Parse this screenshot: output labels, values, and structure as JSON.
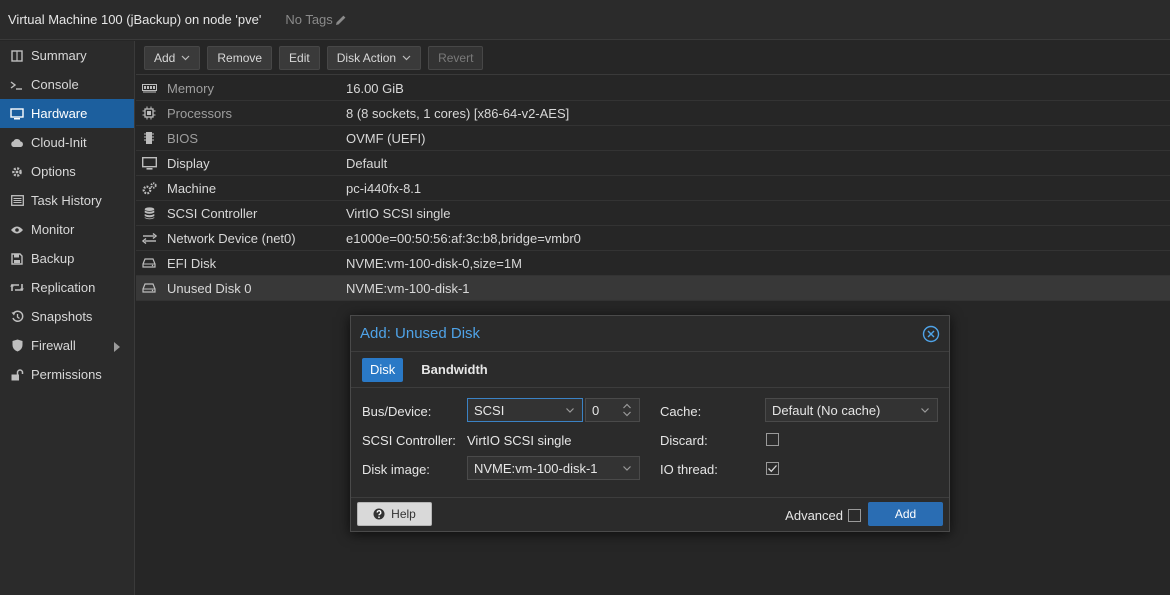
{
  "header": {
    "title": "Virtual Machine 100 (jBackup) on node 'pve'",
    "tags": "No Tags",
    "tags_icon": "pencil-icon"
  },
  "sidebar": {
    "items": [
      {
        "label": "Summary",
        "icon": "book-icon"
      },
      {
        "label": "Console",
        "icon": "terminal-icon"
      },
      {
        "label": "Hardware",
        "icon": "desktop-icon",
        "active": true
      },
      {
        "label": "Cloud-Init",
        "icon": "cloud-icon"
      },
      {
        "label": "Options",
        "icon": "gear-icon"
      },
      {
        "label": "Task History",
        "icon": "list-icon"
      },
      {
        "label": "Monitor",
        "icon": "eye-icon"
      },
      {
        "label": "Backup",
        "icon": "floppy-icon"
      },
      {
        "label": "Replication",
        "icon": "retweet-icon"
      },
      {
        "label": "Snapshots",
        "icon": "history-icon"
      },
      {
        "label": "Firewall",
        "icon": "shield-icon",
        "has_submenu": true
      },
      {
        "label": "Permissions",
        "icon": "unlock-icon"
      }
    ]
  },
  "toolbar": {
    "add_label": "Add",
    "remove_label": "Remove",
    "edit_label": "Edit",
    "disk_action_label": "Disk Action",
    "revert_label": "Revert"
  },
  "hardware": {
    "rows": [
      {
        "name": "Memory",
        "value": "16.00 GiB",
        "icon": "memory-icon",
        "muted": true
      },
      {
        "name": "Processors",
        "value": "8 (8 sockets, 1 cores) [x86-64-v2-AES]",
        "icon": "cpu-icon",
        "muted": true
      },
      {
        "name": "BIOS",
        "value": "OVMF (UEFI)",
        "icon": "microchip-icon",
        "muted": true
      },
      {
        "name": "Display",
        "value": "Default",
        "icon": "desktop-icon"
      },
      {
        "name": "Machine",
        "value": "pc-i440fx-8.1",
        "icon": "cogs-icon"
      },
      {
        "name": "SCSI Controller",
        "value": "VirtIO SCSI single",
        "icon": "database-icon"
      },
      {
        "name": "Network Device (net0)",
        "value": "e1000e=00:50:56:af:3c:b8,bridge=vmbr0",
        "icon": "exchange-icon"
      },
      {
        "name": "EFI Disk",
        "value": "NVME:vm-100-disk-0,size=1M",
        "icon": "hdd-icon"
      },
      {
        "name": "Unused Disk 0",
        "value": "NVME:vm-100-disk-1",
        "icon": "hdd-icon",
        "selected": true
      }
    ]
  },
  "dialog": {
    "title": "Add: Unused Disk",
    "tabs": [
      "Disk",
      "Bandwidth"
    ],
    "bus_device_label": "Bus/Device:",
    "bus_value": "SCSI",
    "device_number": "0",
    "scsi_controller_label": "SCSI Controller:",
    "scsi_controller_value": "VirtIO SCSI single",
    "disk_image_label": "Disk image:",
    "disk_image_value": "NVME:vm-100-disk-1",
    "cache_label": "Cache:",
    "cache_value": "Default (No cache)",
    "discard_label": "Discard:",
    "discard_checked": false,
    "io_thread_label": "IO thread:",
    "io_thread_checked": true,
    "help_label": "Help",
    "advanced_label": "Advanced",
    "advanced_checked": false,
    "add_label": "Add"
  },
  "colors": {
    "accent": "#2a79c6",
    "sidebar_active": "#1c5f9e",
    "dialog_title": "#4fa3e8"
  }
}
